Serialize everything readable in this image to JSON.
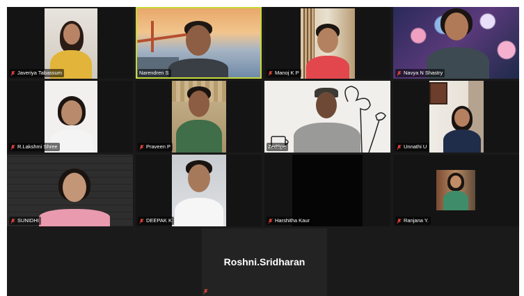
{
  "participants": [
    {
      "name": "Javeriya Tabassum",
      "muted": true
    },
    {
      "name": "Narendren S",
      "muted": false,
      "active_speaker": true
    },
    {
      "name": "Manoj K P",
      "muted": true
    },
    {
      "name": "Navya N Shastry",
      "muted": true
    },
    {
      "name": "R.Lakshmi Shree",
      "muted": true
    },
    {
      "name": "Praveen P",
      "muted": true
    },
    {
      "name": "ZedSpe",
      "muted": false
    },
    {
      "name": "Unnathi U",
      "muted": true
    },
    {
      "name": "SUNIDHI",
      "muted": true
    },
    {
      "name": "DEEPAK K",
      "muted": true
    },
    {
      "name": "Harshitha Kaur",
      "muted": true
    },
    {
      "name": "Ranjana Y.",
      "muted": true
    }
  ],
  "bottom_participant": {
    "name": "Roshni.Sridharan",
    "muted": true
  },
  "icons": {
    "muted": "mic-muted-icon"
  },
  "colors": {
    "active_border": "#c7d93a",
    "muted_icon": "#e0433a",
    "tile_bg": "#141414"
  }
}
